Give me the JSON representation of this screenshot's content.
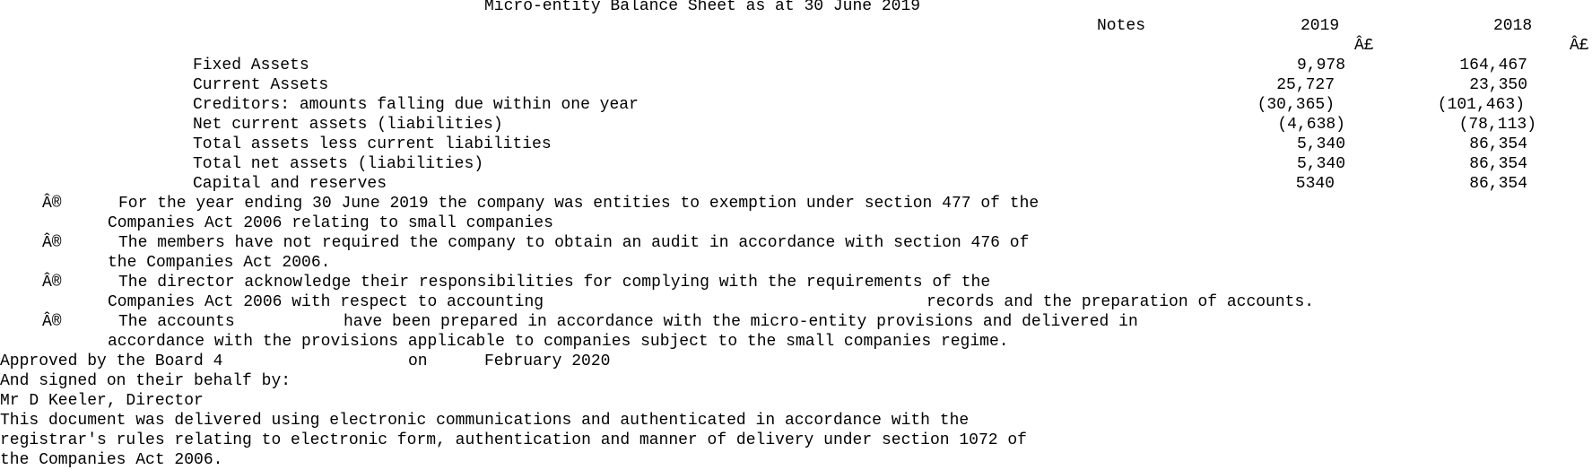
{
  "title": "Micro-entity Balance Sheet as at 30 June 2019",
  "columns": {
    "notes": "Notes",
    "year1": "2019",
    "year2": "2018",
    "currency1": "Â£",
    "currency2": "Â£"
  },
  "rows": [
    {
      "label": "Fixed Assets",
      "v2019": "9,978",
      "v2018": "164,467"
    },
    {
      "label": "Current Assets",
      "v2019": "25,727",
      "v2018": "23,350"
    },
    {
      "label": "Creditors: amounts falling due within one year",
      "v2019": "(30,365)",
      "v2018": "(101,463)"
    },
    {
      "label": "Net current assets (liabilities)",
      "v2019": "(4,638)",
      "v2018": "(78,113)"
    },
    {
      "label": "Total assets less current liabilities",
      "v2019": "5,340",
      "v2018": "86,354"
    },
    {
      "label": "Total net assets (liabilities)",
      "v2019": "5,340",
      "v2018": "86,354"
    },
    {
      "label": "Capital and reserves",
      "v2019": "5340",
      "v2018": "86,354"
    }
  ],
  "bullets": [
    {
      "marker": "Â®",
      "line1": "For the year ending 30 June 2019 the company was entities to exemption under section 477 of the",
      "line2": "Companies Act 2006 relating to small companies"
    },
    {
      "marker": "Â®",
      "line1": "The members have not required the company to obtain an audit in accordance with section 476 of",
      "line2": "the Companies Act 2006."
    },
    {
      "marker": "Â®",
      "line1": "The director acknowledge their responsibilities for complying with the requirements of the",
      "line2a": "Companies Act 2006 with respect to accounting",
      "line2b": "records and the preparation of accounts."
    },
    {
      "marker": "Â®",
      "line1a": "The accounts",
      "line1b": "have been prepared in accordance with the micro-entity provisions and delivered in",
      "line2": "accordance with the provisions applicable to companies subject to the small companies regime."
    }
  ],
  "approval": {
    "approved_by": "Approved by the Board 4",
    "on": "on",
    "date": "February 2020",
    "signed": "And signed on their behalf by:",
    "director": "Mr D Keeler, Director"
  },
  "footer": {
    "line1": "This document was delivered using electronic communications and authenticated in accordance with the",
    "line2": "registrar's rules relating to electronic form, authentication and manner of delivery under section 1072 of",
    "line3": "the Companies Act 2006."
  }
}
